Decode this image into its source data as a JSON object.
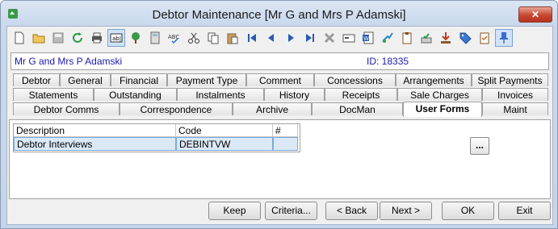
{
  "window": {
    "title": "Debtor Maintenance  [Mr G and Mrs P Adamski]",
    "close_label": "✕"
  },
  "toolbar": {
    "icons": [
      "new-icon",
      "open-folder-icon",
      "save-icon",
      "refresh-icon",
      "print-icon",
      "text-field-icon",
      "tree-icon",
      "calculator-icon",
      "spellcheck-icon",
      "cut-icon",
      "copy-icon",
      "paste-icon",
      "first-record-icon",
      "previous-record-icon",
      "next-record-icon",
      "last-record-icon",
      "delete-icon",
      "card-icon",
      "word-doc-icon",
      "arrow-icon",
      "clipboard-icon",
      "approve-icon",
      "download-icon",
      "tag-icon",
      "checklist-icon",
      "pin-icon"
    ]
  },
  "info": {
    "name": "Mr G and Mrs P Adamski",
    "id": "ID: 18335"
  },
  "tabs": {
    "row1": [
      "Debtor",
      "General",
      "Financial",
      "Payment Type",
      "Comment",
      "Concessions",
      "Arrangements",
      "Split Payments"
    ],
    "row2": [
      "Statements",
      "Outstanding",
      "Instalments",
      "History",
      "Receipts",
      "Sale Charges",
      "Invoices"
    ],
    "row3": [
      "Debtor Comms",
      "Correspondence",
      "Archive",
      "DocMan",
      "User Forms",
      "Maint"
    ]
  },
  "grid": {
    "headers": [
      "Description",
      "Code",
      "#"
    ],
    "rows": [
      [
        "Debtor Interviews",
        "DEBINTVW",
        ""
      ]
    ]
  },
  "more_label": "...",
  "buttons": {
    "keep": "Keep",
    "criteria": "Criteria...",
    "back": "< Back",
    "next": "Next >",
    "ok": "OK",
    "exit": "Exit"
  },
  "colors": {
    "accent_text": "#1a1aaa",
    "selected_row": "#dbe9f7",
    "close_button": "#c7462f"
  }
}
